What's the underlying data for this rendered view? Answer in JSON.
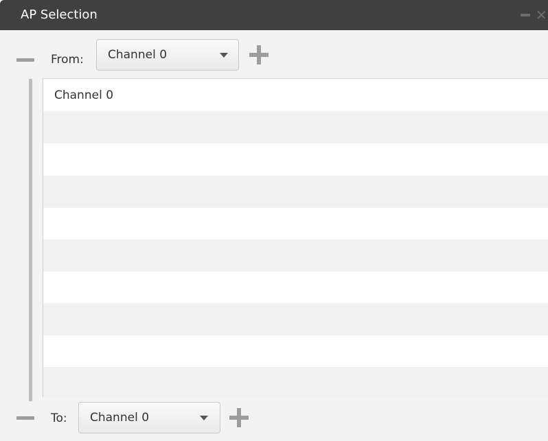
{
  "window": {
    "title": "AP Selection"
  },
  "from": {
    "label": "From:",
    "selected": "Channel 0"
  },
  "list": {
    "items": [
      "Channel 0"
    ]
  },
  "to": {
    "label": "To:",
    "selected": "Channel 0"
  },
  "icons": {
    "minimize": "minimize-icon",
    "close": "close-icon",
    "remove": "minus-icon",
    "add": "plus-icon",
    "dropdown": "chevron-down-icon"
  }
}
